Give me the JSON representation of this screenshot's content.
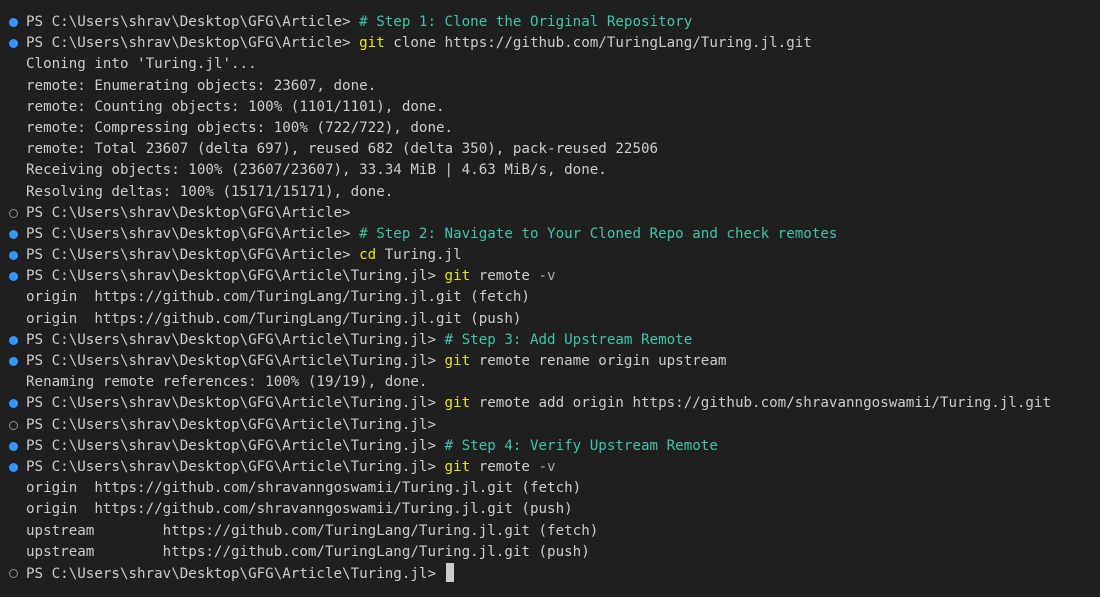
{
  "terminal": {
    "lines": [
      {
        "decor": "success",
        "prompt": "PS C:\\Users\\shrav\\Desktop\\GFG\\Article> ",
        "comment": "# Step 1: Clone the Original Repository"
      },
      {
        "decor": "success",
        "prompt": "PS C:\\Users\\shrav\\Desktop\\GFG\\Article> ",
        "cmd": "git",
        "args": " clone https://github.com/TuringLang/Turing.jl.git"
      },
      {
        "output": "Cloning into 'Turing.jl'..."
      },
      {
        "output": "remote: Enumerating objects: 23607, done."
      },
      {
        "output": "remote: Counting objects: 100% (1101/1101), done."
      },
      {
        "output": "remote: Compressing objects: 100% (722/722), done."
      },
      {
        "output": "remote: Total 23607 (delta 697), reused 682 (delta 350), pack-reused 22506"
      },
      {
        "output": "Receiving objects: 100% (23607/23607), 33.34 MiB | 4.63 MiB/s, done."
      },
      {
        "output": "Resolving deltas: 100% (15171/15171), done."
      },
      {
        "decor": "empty",
        "prompt": "PS C:\\Users\\shrav\\Desktop\\GFG\\Article>"
      },
      {
        "decor": "success",
        "prompt": "PS C:\\Users\\shrav\\Desktop\\GFG\\Article> ",
        "comment": "# Step 2: Navigate to Your Cloned Repo and check remotes"
      },
      {
        "decor": "success",
        "prompt": "PS C:\\Users\\shrav\\Desktop\\GFG\\Article> ",
        "cmd": "cd",
        "args": " Turing.jl"
      },
      {
        "decor": "success",
        "prompt": "PS C:\\Users\\shrav\\Desktop\\GFG\\Article\\Turing.jl> ",
        "cmd": "git",
        "args": " remote ",
        "flag": "-v"
      },
      {
        "output": "origin  https://github.com/TuringLang/Turing.jl.git (fetch)"
      },
      {
        "output": "origin  https://github.com/TuringLang/Turing.jl.git (push)"
      },
      {
        "decor": "success",
        "prompt": "PS C:\\Users\\shrav\\Desktop\\GFG\\Article\\Turing.jl> ",
        "comment": "# Step 3: Add Upstream Remote"
      },
      {
        "decor": "success",
        "prompt": "PS C:\\Users\\shrav\\Desktop\\GFG\\Article\\Turing.jl> ",
        "cmd": "git",
        "args": " remote rename origin upstream"
      },
      {
        "output": "Renaming remote references: 100% (19/19), done."
      },
      {
        "decor": "success",
        "prompt": "PS C:\\Users\\shrav\\Desktop\\GFG\\Article\\Turing.jl> ",
        "cmd": "git",
        "args": " remote add origin https://github.com/shravanngoswamii/Turing.jl.git"
      },
      {
        "decor": "empty",
        "prompt": "PS C:\\Users\\shrav\\Desktop\\GFG\\Article\\Turing.jl>"
      },
      {
        "decor": "success",
        "prompt": "PS C:\\Users\\shrav\\Desktop\\GFG\\Article\\Turing.jl> ",
        "comment": "# Step 4: Verify Upstream Remote"
      },
      {
        "decor": "success",
        "prompt": "PS C:\\Users\\shrav\\Desktop\\GFG\\Article\\Turing.jl> ",
        "cmd": "git",
        "args": " remote ",
        "flag": "-v"
      },
      {
        "output": "origin  https://github.com/shravanngoswamii/Turing.jl.git (fetch)"
      },
      {
        "output": "origin  https://github.com/shravanngoswamii/Turing.jl.git (push)"
      },
      {
        "output": "upstream        https://github.com/TuringLang/Turing.jl.git (fetch)"
      },
      {
        "output": "upstream        https://github.com/TuringLang/Turing.jl.git (push)"
      },
      {
        "decor": "empty",
        "prompt": "PS C:\\Users\\shrav\\Desktop\\GFG\\Article\\Turing.jl> ",
        "cursor": true
      }
    ]
  },
  "colors": {
    "background": "#1f1f1f",
    "text": "#cccccc",
    "command": "#e5e510",
    "comment": "#3ec4a8",
    "success_decoration": "#3794ff",
    "empty_decoration": "#8f8f8f"
  }
}
